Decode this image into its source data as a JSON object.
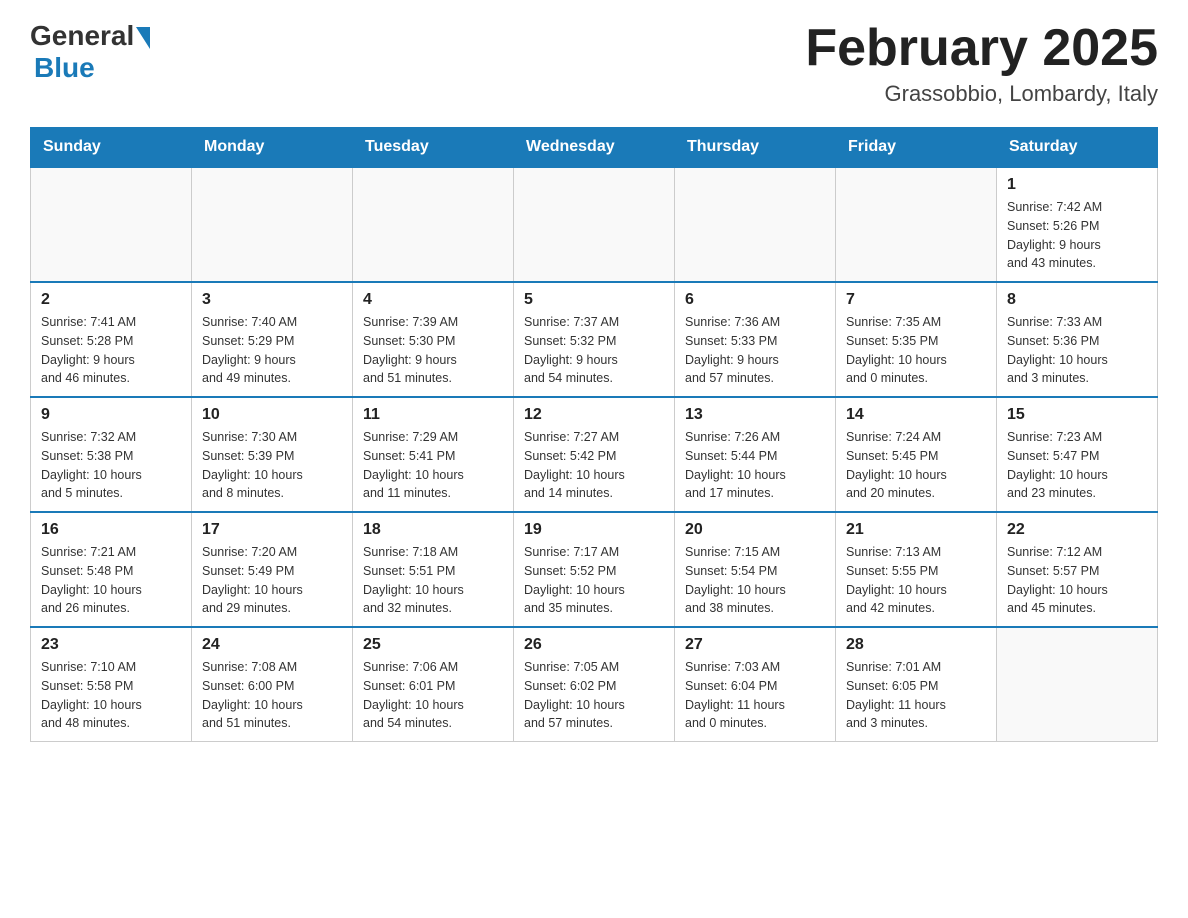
{
  "header": {
    "logo": {
      "general": "General",
      "blue": "Blue"
    },
    "title": "February 2025",
    "subtitle": "Grassobbio, Lombardy, Italy"
  },
  "weekdays": [
    "Sunday",
    "Monday",
    "Tuesday",
    "Wednesday",
    "Thursday",
    "Friday",
    "Saturday"
  ],
  "weeks": [
    [
      {
        "day": "",
        "info": ""
      },
      {
        "day": "",
        "info": ""
      },
      {
        "day": "",
        "info": ""
      },
      {
        "day": "",
        "info": ""
      },
      {
        "day": "",
        "info": ""
      },
      {
        "day": "",
        "info": ""
      },
      {
        "day": "1",
        "info": "Sunrise: 7:42 AM\nSunset: 5:26 PM\nDaylight: 9 hours\nand 43 minutes."
      }
    ],
    [
      {
        "day": "2",
        "info": "Sunrise: 7:41 AM\nSunset: 5:28 PM\nDaylight: 9 hours\nand 46 minutes."
      },
      {
        "day": "3",
        "info": "Sunrise: 7:40 AM\nSunset: 5:29 PM\nDaylight: 9 hours\nand 49 minutes."
      },
      {
        "day": "4",
        "info": "Sunrise: 7:39 AM\nSunset: 5:30 PM\nDaylight: 9 hours\nand 51 minutes."
      },
      {
        "day": "5",
        "info": "Sunrise: 7:37 AM\nSunset: 5:32 PM\nDaylight: 9 hours\nand 54 minutes."
      },
      {
        "day": "6",
        "info": "Sunrise: 7:36 AM\nSunset: 5:33 PM\nDaylight: 9 hours\nand 57 minutes."
      },
      {
        "day": "7",
        "info": "Sunrise: 7:35 AM\nSunset: 5:35 PM\nDaylight: 10 hours\nand 0 minutes."
      },
      {
        "day": "8",
        "info": "Sunrise: 7:33 AM\nSunset: 5:36 PM\nDaylight: 10 hours\nand 3 minutes."
      }
    ],
    [
      {
        "day": "9",
        "info": "Sunrise: 7:32 AM\nSunset: 5:38 PM\nDaylight: 10 hours\nand 5 minutes."
      },
      {
        "day": "10",
        "info": "Sunrise: 7:30 AM\nSunset: 5:39 PM\nDaylight: 10 hours\nand 8 minutes."
      },
      {
        "day": "11",
        "info": "Sunrise: 7:29 AM\nSunset: 5:41 PM\nDaylight: 10 hours\nand 11 minutes."
      },
      {
        "day": "12",
        "info": "Sunrise: 7:27 AM\nSunset: 5:42 PM\nDaylight: 10 hours\nand 14 minutes."
      },
      {
        "day": "13",
        "info": "Sunrise: 7:26 AM\nSunset: 5:44 PM\nDaylight: 10 hours\nand 17 minutes."
      },
      {
        "day": "14",
        "info": "Sunrise: 7:24 AM\nSunset: 5:45 PM\nDaylight: 10 hours\nand 20 minutes."
      },
      {
        "day": "15",
        "info": "Sunrise: 7:23 AM\nSunset: 5:47 PM\nDaylight: 10 hours\nand 23 minutes."
      }
    ],
    [
      {
        "day": "16",
        "info": "Sunrise: 7:21 AM\nSunset: 5:48 PM\nDaylight: 10 hours\nand 26 minutes."
      },
      {
        "day": "17",
        "info": "Sunrise: 7:20 AM\nSunset: 5:49 PM\nDaylight: 10 hours\nand 29 minutes."
      },
      {
        "day": "18",
        "info": "Sunrise: 7:18 AM\nSunset: 5:51 PM\nDaylight: 10 hours\nand 32 minutes."
      },
      {
        "day": "19",
        "info": "Sunrise: 7:17 AM\nSunset: 5:52 PM\nDaylight: 10 hours\nand 35 minutes."
      },
      {
        "day": "20",
        "info": "Sunrise: 7:15 AM\nSunset: 5:54 PM\nDaylight: 10 hours\nand 38 minutes."
      },
      {
        "day": "21",
        "info": "Sunrise: 7:13 AM\nSunset: 5:55 PM\nDaylight: 10 hours\nand 42 minutes."
      },
      {
        "day": "22",
        "info": "Sunrise: 7:12 AM\nSunset: 5:57 PM\nDaylight: 10 hours\nand 45 minutes."
      }
    ],
    [
      {
        "day": "23",
        "info": "Sunrise: 7:10 AM\nSunset: 5:58 PM\nDaylight: 10 hours\nand 48 minutes."
      },
      {
        "day": "24",
        "info": "Sunrise: 7:08 AM\nSunset: 6:00 PM\nDaylight: 10 hours\nand 51 minutes."
      },
      {
        "day": "25",
        "info": "Sunrise: 7:06 AM\nSunset: 6:01 PM\nDaylight: 10 hours\nand 54 minutes."
      },
      {
        "day": "26",
        "info": "Sunrise: 7:05 AM\nSunset: 6:02 PM\nDaylight: 10 hours\nand 57 minutes."
      },
      {
        "day": "27",
        "info": "Sunrise: 7:03 AM\nSunset: 6:04 PM\nDaylight: 11 hours\nand 0 minutes."
      },
      {
        "day": "28",
        "info": "Sunrise: 7:01 AM\nSunset: 6:05 PM\nDaylight: 11 hours\nand 3 minutes."
      },
      {
        "day": "",
        "info": ""
      }
    ]
  ]
}
